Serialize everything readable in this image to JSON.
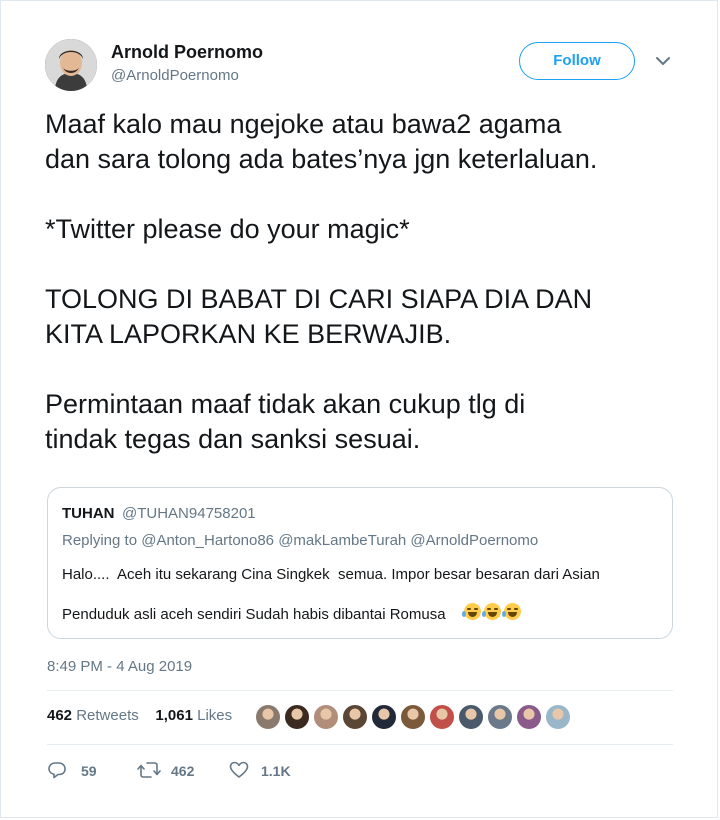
{
  "author": {
    "name": "Arnold Poernomo",
    "handle": "@ArnoldPoernomo"
  },
  "follow_label": "Follow",
  "tweet_lines": [
    "Maaf kalo mau ngejoke atau bawa2 agama",
    "dan sara tolong ada bates’nya jgn keterlaluan.",
    "",
    "*Twitter please do your magic*",
    "",
    "TOLONG DI BABAT DI CARI SIAPA DIA DAN",
    "KITA LAPORKAN KE BERWAJIB.",
    "",
    "Permintaan maaf tidak akan cukup tlg di",
    "tindak tegas dan sanksi sesuai."
  ],
  "quoted": {
    "name": "TUHAN",
    "handle": "@TUHAN94758201",
    "replying_to": "Replying to @Anton_Hartono86 @makLambeTurah @ArnoldPoernomo",
    "line1": "Halo....  Aceh itu sekarang Cina Singkek  semua. Impor besar besaran dari Asian",
    "line2": "Penduduk asli aceh sendiri Sudah habis dibantai Romusa",
    "emoji": [
      "face-with-tears-of-joy",
      "face-with-tears-of-joy",
      "face-with-tears-of-joy"
    ]
  },
  "timestamp": "8:49 PM - 4 Aug 2019",
  "stats": {
    "retweets_count": "462",
    "retweets_label": "Retweets",
    "likes_count": "1,061",
    "likes_label": "Likes"
  },
  "likers_colors": [
    "#8a7a6e",
    "#3b2a22",
    "#b08e7a",
    "#5a4634",
    "#222a3a",
    "#7a5a3a",
    "#c2504a",
    "#4a5a6a",
    "#6a7a8a",
    "#8a5a8a",
    "#9ab6c9"
  ],
  "actions": {
    "replies": "59",
    "retweets": "462",
    "likes": "1.1K"
  },
  "colors": {
    "accent": "#1da1f2",
    "secondary_text": "#657786",
    "border": "#e1e8ed"
  }
}
